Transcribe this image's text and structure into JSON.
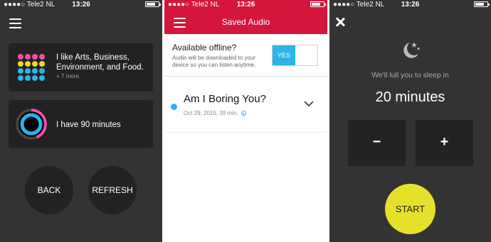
{
  "status_bar": {
    "carrier": "●●●●○ Tele2 NL",
    "time": "13:26"
  },
  "colors": {
    "brand_red": "#d3163a",
    "accent_blue": "#2cb4e9",
    "start_yellow": "#e5e12b",
    "dark_bg": "#333333",
    "card_bg": "#222222"
  },
  "screen1": {
    "interests_card": {
      "text": "I like Arts, Business, Environment, and Food.",
      "subtext": "+ 7 more."
    },
    "time_card": {
      "text": "I have 90 minutes"
    },
    "back_button": "BACK",
    "refresh_button": "REFRESH"
  },
  "screen2": {
    "header_title": "Saved Audio",
    "offline": {
      "question": "Available offline?",
      "description": "Audio will be downloaded to your device so you can listen anytime.",
      "toggle_label": "YES"
    },
    "episode": {
      "title": "Am I Boring You?",
      "meta": "Oct 29, 2015, 39 min."
    }
  },
  "screen3": {
    "lull_text": "We'll lull you to sleep in",
    "duration": "20 minutes",
    "minus_label": "−",
    "plus_label": "+",
    "start_label": "START"
  }
}
